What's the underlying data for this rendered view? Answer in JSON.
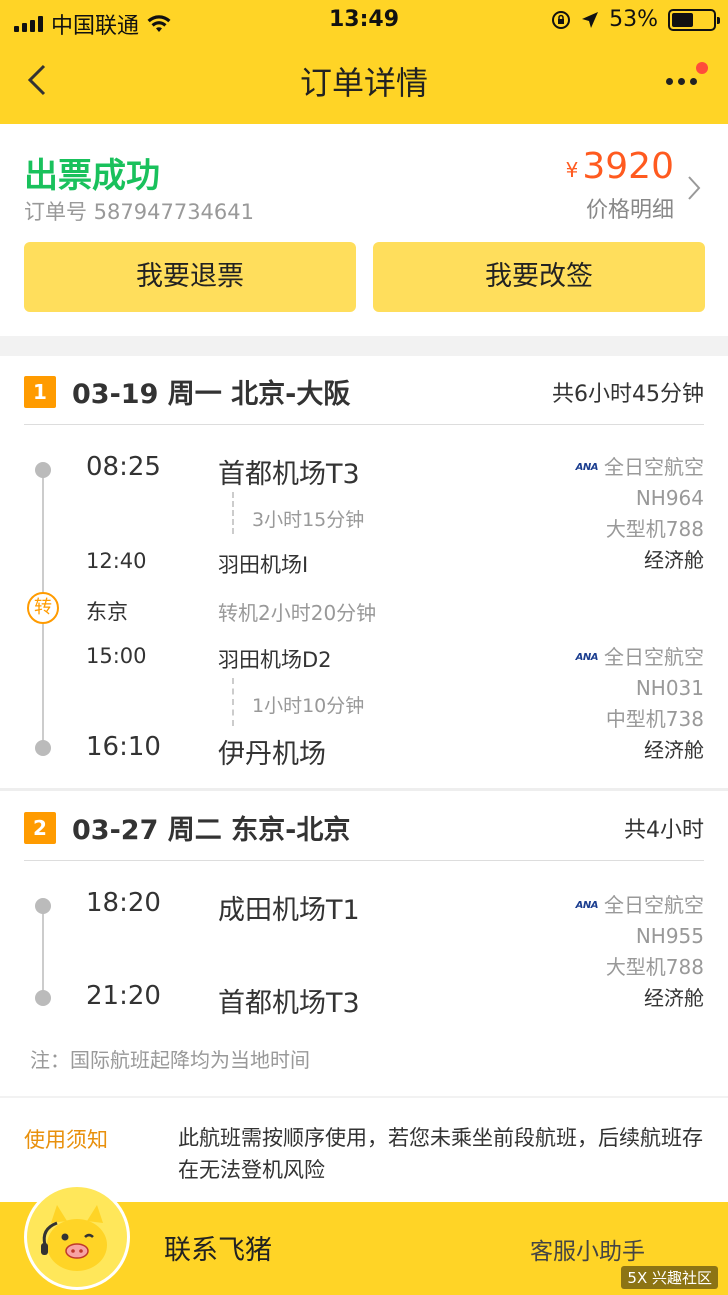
{
  "status_bar": {
    "carrier": "中国联通",
    "time": "13:49",
    "battery": "53%"
  },
  "nav": {
    "title": "订单详情"
  },
  "order": {
    "status": "出票成功",
    "order_no": "订单号 587947734641",
    "currency": "¥",
    "price": "3920",
    "price_detail": "价格明细",
    "refund_label": "我要退票",
    "change_label": "我要改签"
  },
  "segments": [
    {
      "index": "1",
      "title": "03-19 周一 北京-大阪",
      "total": "共6小时45分钟",
      "legs": [
        {
          "dep_time": "08:25",
          "dep_airport": "首都机场T3",
          "duration": "3小时15分钟",
          "arr_time": "12:40",
          "arr_airport": "羽田机场I",
          "airline": "全日空航空",
          "flight": "NH964",
          "aircraft": "大型机788",
          "cabin": "经济舱"
        },
        {
          "dep_time": "15:00",
          "dep_airport": "羽田机场D2",
          "duration": "1小时10分钟",
          "arr_time": "16:10",
          "arr_airport": "伊丹机场",
          "airline": "全日空航空",
          "flight": "NH031",
          "aircraft": "中型机738",
          "cabin": "经济舱"
        }
      ],
      "transfer": {
        "badge": "转",
        "city": "东京",
        "text": "转机2小时20分钟"
      }
    },
    {
      "index": "2",
      "title": "03-27 周二 东京-北京",
      "total": "共4小时",
      "legs": [
        {
          "dep_time": "18:20",
          "dep_airport": "成田机场T1",
          "arr_time": "21:20",
          "arr_airport": "首都机场T3",
          "airline": "全日空航空",
          "flight": "NH955",
          "aircraft": "大型机788",
          "cabin": "经济舱"
        }
      ]
    }
  ],
  "airline_logo_text": "ANA",
  "note": "注：国际航班起降均为当地时间",
  "notice": {
    "label": "使用须知",
    "text": "此航班需按顺序使用，若您未乘坐前段航班，后续航班存在无法登机风险"
  },
  "bottom": {
    "contact": "联系飞猪",
    "assistant": "客服小助手"
  },
  "watermark": "5X 兴趣社区",
  "colors": {
    "brand_yellow": "#ffd426",
    "success_green": "#19c15c",
    "price_orange": "#ff5a1f",
    "accent_orange": "#ff9b00"
  }
}
